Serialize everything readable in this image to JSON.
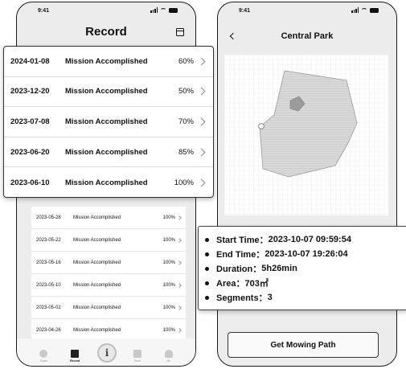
{
  "left_phone": {
    "status_time": "9:41",
    "title": "Record",
    "records_highlighted": [
      {
        "date": "2024-01-08",
        "status": "Mission Accomplished",
        "percent": "60%"
      },
      {
        "date": "2023-12-20",
        "status": "Mission Accomplished",
        "percent": "50%"
      },
      {
        "date": "2023-07-08",
        "status": "Mission Accomplished",
        "percent": "70%"
      },
      {
        "date": "2023-06-20",
        "status": "Mission Accomplished",
        "percent": "85%"
      },
      {
        "date": "2023-06-10",
        "status": "Mission Accomplished",
        "percent": "100%"
      }
    ],
    "records": [
      {
        "date": "2023-05-28",
        "status": "Mission Accomplished",
        "percent": "100%"
      },
      {
        "date": "2023-05-22",
        "status": "Mission Accomplished",
        "percent": "100%"
      },
      {
        "date": "2023-05-16",
        "status": "Mission Accomplished",
        "percent": "100%"
      },
      {
        "date": "2023-05-10",
        "status": "Mission Accomplished",
        "percent": "100%"
      },
      {
        "date": "2023-05-02",
        "status": "Mission Accomplished",
        "percent": "100%"
      },
      {
        "date": "2023-04-26",
        "status": "Mission Accomplished",
        "percent": "100%"
      }
    ],
    "tabs": [
      {
        "label": "Guide",
        "icon": "guide-icon"
      },
      {
        "label": "Record",
        "icon": "record-icon",
        "active": true
      },
      {
        "label": "Store",
        "icon": "store-icon"
      },
      {
        "label": "Me",
        "icon": "me-icon"
      }
    ],
    "center_button_glyph": "i"
  },
  "right_phone": {
    "status_time": "9:41",
    "title": "Central Park",
    "info": [
      {
        "label": "Start Time：",
        "value": "2023-10-07 09:59:54"
      },
      {
        "label": "End Time：",
        "value": "2023-10-07 19:26:04"
      },
      {
        "label": "Duration：",
        "value": "5h26min"
      },
      {
        "label": "Area：",
        "value": "703㎡"
      },
      {
        "label": "Segments：",
        "value": "3"
      }
    ],
    "get_path_button": "Get Mowing Path"
  },
  "colors": {
    "map_fill": "#d9d9d9",
    "map_grid": "#e2e2e2",
    "obstacle": "#9c9c9c"
  }
}
